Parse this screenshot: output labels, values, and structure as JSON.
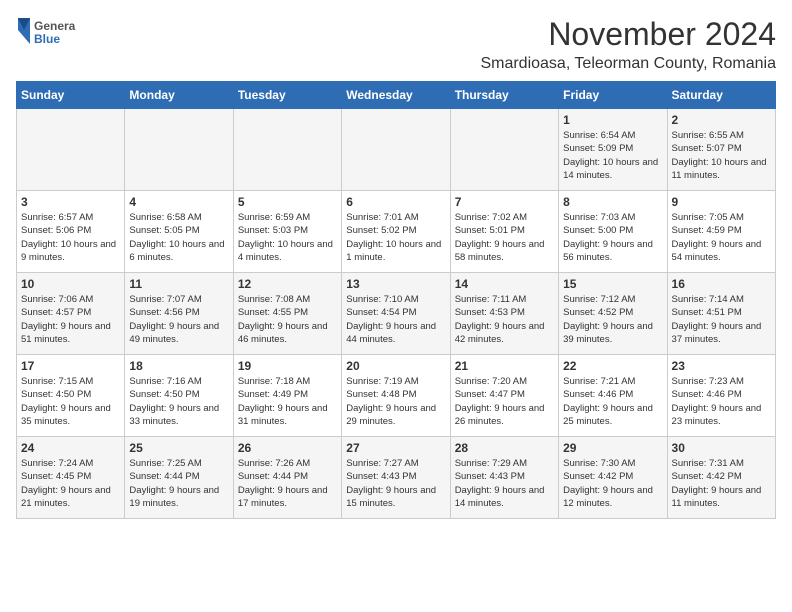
{
  "header": {
    "logo": {
      "general": "General",
      "blue": "Blue"
    },
    "title": "November 2024",
    "subtitle": "Smardioasa, Teleorman County, Romania"
  },
  "calendar": {
    "weekdays": [
      "Sunday",
      "Monday",
      "Tuesday",
      "Wednesday",
      "Thursday",
      "Friday",
      "Saturday"
    ],
    "weeks": [
      [
        {
          "day": "",
          "info": ""
        },
        {
          "day": "",
          "info": ""
        },
        {
          "day": "",
          "info": ""
        },
        {
          "day": "",
          "info": ""
        },
        {
          "day": "",
          "info": ""
        },
        {
          "day": "1",
          "info": "Sunrise: 6:54 AM\nSunset: 5:09 PM\nDaylight: 10 hours and 14 minutes."
        },
        {
          "day": "2",
          "info": "Sunrise: 6:55 AM\nSunset: 5:07 PM\nDaylight: 10 hours and 11 minutes."
        }
      ],
      [
        {
          "day": "3",
          "info": "Sunrise: 6:57 AM\nSunset: 5:06 PM\nDaylight: 10 hours and 9 minutes."
        },
        {
          "day": "4",
          "info": "Sunrise: 6:58 AM\nSunset: 5:05 PM\nDaylight: 10 hours and 6 minutes."
        },
        {
          "day": "5",
          "info": "Sunrise: 6:59 AM\nSunset: 5:03 PM\nDaylight: 10 hours and 4 minutes."
        },
        {
          "day": "6",
          "info": "Sunrise: 7:01 AM\nSunset: 5:02 PM\nDaylight: 10 hours and 1 minute."
        },
        {
          "day": "7",
          "info": "Sunrise: 7:02 AM\nSunset: 5:01 PM\nDaylight: 9 hours and 58 minutes."
        },
        {
          "day": "8",
          "info": "Sunrise: 7:03 AM\nSunset: 5:00 PM\nDaylight: 9 hours and 56 minutes."
        },
        {
          "day": "9",
          "info": "Sunrise: 7:05 AM\nSunset: 4:59 PM\nDaylight: 9 hours and 54 minutes."
        }
      ],
      [
        {
          "day": "10",
          "info": "Sunrise: 7:06 AM\nSunset: 4:57 PM\nDaylight: 9 hours and 51 minutes."
        },
        {
          "day": "11",
          "info": "Sunrise: 7:07 AM\nSunset: 4:56 PM\nDaylight: 9 hours and 49 minutes."
        },
        {
          "day": "12",
          "info": "Sunrise: 7:08 AM\nSunset: 4:55 PM\nDaylight: 9 hours and 46 minutes."
        },
        {
          "day": "13",
          "info": "Sunrise: 7:10 AM\nSunset: 4:54 PM\nDaylight: 9 hours and 44 minutes."
        },
        {
          "day": "14",
          "info": "Sunrise: 7:11 AM\nSunset: 4:53 PM\nDaylight: 9 hours and 42 minutes."
        },
        {
          "day": "15",
          "info": "Sunrise: 7:12 AM\nSunset: 4:52 PM\nDaylight: 9 hours and 39 minutes."
        },
        {
          "day": "16",
          "info": "Sunrise: 7:14 AM\nSunset: 4:51 PM\nDaylight: 9 hours and 37 minutes."
        }
      ],
      [
        {
          "day": "17",
          "info": "Sunrise: 7:15 AM\nSunset: 4:50 PM\nDaylight: 9 hours and 35 minutes."
        },
        {
          "day": "18",
          "info": "Sunrise: 7:16 AM\nSunset: 4:50 PM\nDaylight: 9 hours and 33 minutes."
        },
        {
          "day": "19",
          "info": "Sunrise: 7:18 AM\nSunset: 4:49 PM\nDaylight: 9 hours and 31 minutes."
        },
        {
          "day": "20",
          "info": "Sunrise: 7:19 AM\nSunset: 4:48 PM\nDaylight: 9 hours and 29 minutes."
        },
        {
          "day": "21",
          "info": "Sunrise: 7:20 AM\nSunset: 4:47 PM\nDaylight: 9 hours and 26 minutes."
        },
        {
          "day": "22",
          "info": "Sunrise: 7:21 AM\nSunset: 4:46 PM\nDaylight: 9 hours and 25 minutes."
        },
        {
          "day": "23",
          "info": "Sunrise: 7:23 AM\nSunset: 4:46 PM\nDaylight: 9 hours and 23 minutes."
        }
      ],
      [
        {
          "day": "24",
          "info": "Sunrise: 7:24 AM\nSunset: 4:45 PM\nDaylight: 9 hours and 21 minutes."
        },
        {
          "day": "25",
          "info": "Sunrise: 7:25 AM\nSunset: 4:44 PM\nDaylight: 9 hours and 19 minutes."
        },
        {
          "day": "26",
          "info": "Sunrise: 7:26 AM\nSunset: 4:44 PM\nDaylight: 9 hours and 17 minutes."
        },
        {
          "day": "27",
          "info": "Sunrise: 7:27 AM\nSunset: 4:43 PM\nDaylight: 9 hours and 15 minutes."
        },
        {
          "day": "28",
          "info": "Sunrise: 7:29 AM\nSunset: 4:43 PM\nDaylight: 9 hours and 14 minutes."
        },
        {
          "day": "29",
          "info": "Sunrise: 7:30 AM\nSunset: 4:42 PM\nDaylight: 9 hours and 12 minutes."
        },
        {
          "day": "30",
          "info": "Sunrise: 7:31 AM\nSunset: 4:42 PM\nDaylight: 9 hours and 11 minutes."
        }
      ]
    ]
  }
}
